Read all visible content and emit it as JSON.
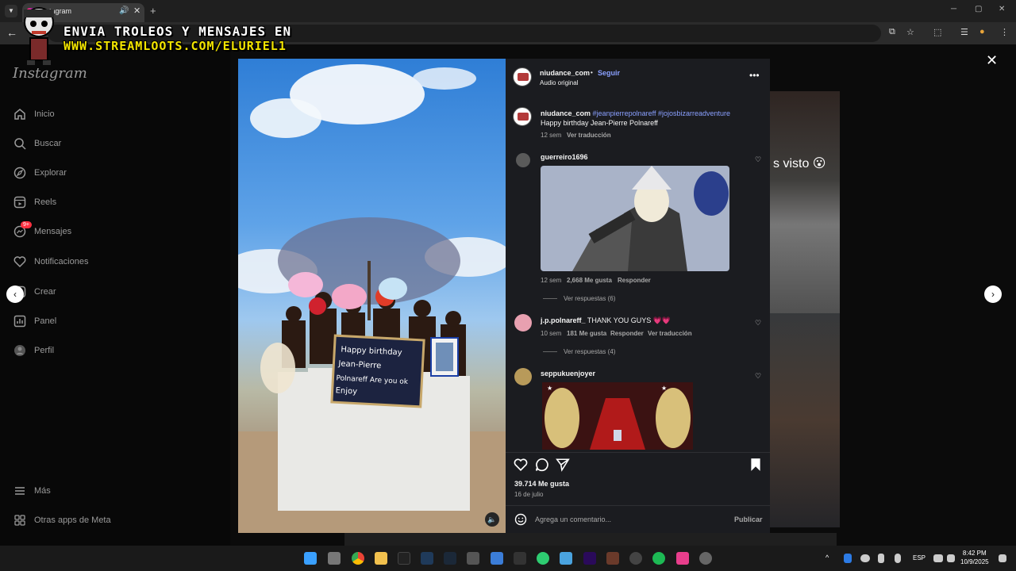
{
  "browser": {
    "tab_title": "Instagram",
    "new_tab": "+",
    "close_tab": "✕"
  },
  "overlay": {
    "line1": "ENVIA TROLEOS Y MENSAJES EN",
    "line2": "WWW.STREAMLOOTS.COM/ELURIEL1"
  },
  "sidebar": {
    "logo": "Instagram",
    "items": [
      {
        "label": "Inicio"
      },
      {
        "label": "Buscar"
      },
      {
        "label": "Explorar"
      },
      {
        "label": "Reels"
      },
      {
        "label": "Mensajes",
        "badge": "9+"
      },
      {
        "label": "Notificaciones"
      },
      {
        "label": "Crear"
      },
      {
        "label": "Panel"
      },
      {
        "label": "Perfil"
      }
    ],
    "more": "Más",
    "meta_apps": "Otras apps de Meta"
  },
  "background": {
    "tile_text": "s visto 😮"
  },
  "post": {
    "author": "niudance_com",
    "follow": "Seguir",
    "audio": "Audio original",
    "caption_tags": "#jeanpierrepolnareff #jojosbizarreadventure",
    "caption_text": "Happy birthday Jean-Pierre Polnareff",
    "caption_age": "12 sem",
    "caption_translate": "Ver traducción",
    "sign_text": [
      "Happy birthday",
      "Jean-Pierre",
      "Polnareff Are you ok",
      "Enjoy"
    ],
    "likes": "39.714 Me gusta",
    "date": "16 de julio",
    "comment_placeholder": "Agrega un comentario...",
    "publish": "Publicar"
  },
  "comments": [
    {
      "user": "guerreiro1696",
      "text": "",
      "age": "12 sem",
      "likes": "2,668 Me gusta",
      "reply": "Responder",
      "translate": "",
      "replies": "Ver respuestas (6)"
    },
    {
      "user": "j.p.polnareff_",
      "text": "THANK YOU GUYS 💗💗",
      "age": "10 sem",
      "likes": "181 Me gusta",
      "reply": "Responder",
      "translate": "Ver traducción",
      "replies": "Ver respuestas (4)"
    },
    {
      "user": "seppukuenjoyer",
      "text": "",
      "age": "",
      "likes": "",
      "reply": "",
      "translate": "",
      "replies": ""
    }
  ],
  "taskbar": {
    "lang": "ESP",
    "time": "8:42 PM",
    "date": "10/9/2025"
  },
  "colors": {
    "panel_bg": "#1b1c20",
    "link_blue": "#8aa0ff",
    "badge_red": "#ff3040"
  }
}
